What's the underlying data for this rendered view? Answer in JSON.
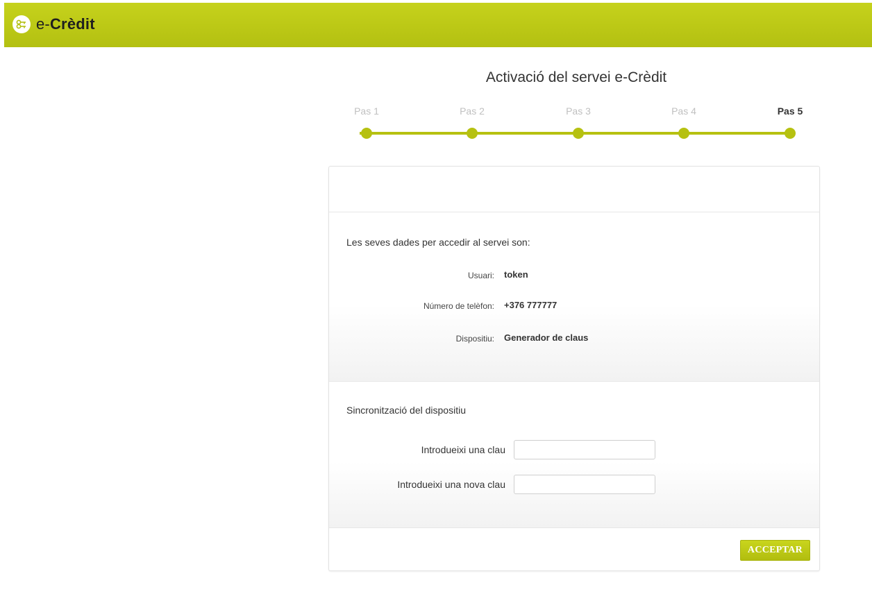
{
  "header": {
    "logo_prefix": "e-",
    "logo_name": "Crèdit",
    "brand_color": "#b8c414"
  },
  "page": {
    "title": "Activació del servei e-Crèdit"
  },
  "steps": {
    "items": [
      {
        "label": "Pas 1",
        "active": false
      },
      {
        "label": "Pas 2",
        "active": false
      },
      {
        "label": "Pas 3",
        "active": false
      },
      {
        "label": "Pas 4",
        "active": false
      },
      {
        "label": "Pas 5",
        "active": true
      }
    ]
  },
  "data_section": {
    "heading": "Les seves dades per accedir al servei son:",
    "user_label": "Usuari:",
    "user_value": "token",
    "phone_label": "Número de telèfon:",
    "phone_value": "+376 777777",
    "device_label": "Dispositiu:",
    "device_value": "Generador de claus"
  },
  "sync_section": {
    "heading": "Sincronització del dispositiu",
    "key_label": "Introdueixi una clau",
    "key_value": "",
    "new_key_label": "Introdueixi una nova clau",
    "new_key_value": ""
  },
  "actions": {
    "accept_label": "ACCEPTAR"
  }
}
